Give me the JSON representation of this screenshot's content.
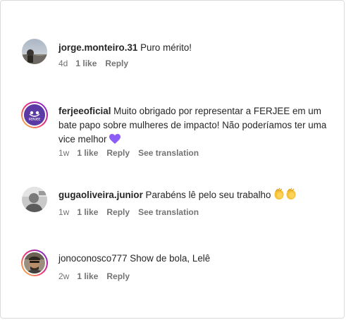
{
  "comments": [
    {
      "username": "jorge.monteiro.31",
      "text": "Puro mérito!",
      "time": "4d",
      "likes": "1 like",
      "reply": "Reply"
    },
    {
      "username": "ferjeeoficial",
      "text": "Muito obrigado por representar a FERJEE em um bate papo sobre mulheres de impacto! Não poderíamos ter uma vice melhor",
      "emoji": "purple-heart-icon",
      "time": "1w",
      "likes": "1 like",
      "reply": "Reply",
      "translate": "See translation",
      "avatar_text": "FERJEE"
    },
    {
      "username": "gugaoliveira.junior",
      "text": "Parabéns lê pelo seu trabalho",
      "emoji": "clapping-hands-icon",
      "time": "1w",
      "likes": "1 like",
      "reply": "Reply",
      "translate": "See translation"
    },
    {
      "username": "jonoconosco777",
      "text": "Show de bola, Lelê",
      "time": "2w",
      "likes": "1 like",
      "reply": "Reply"
    }
  ],
  "colors": {
    "text": "#262626",
    "meta": "#737373",
    "ring_start": "#f9ce34",
    "ring_mid": "#ee2a7b",
    "ring_end": "#6228d7",
    "ferjee_purple": "#5b3aa6"
  }
}
